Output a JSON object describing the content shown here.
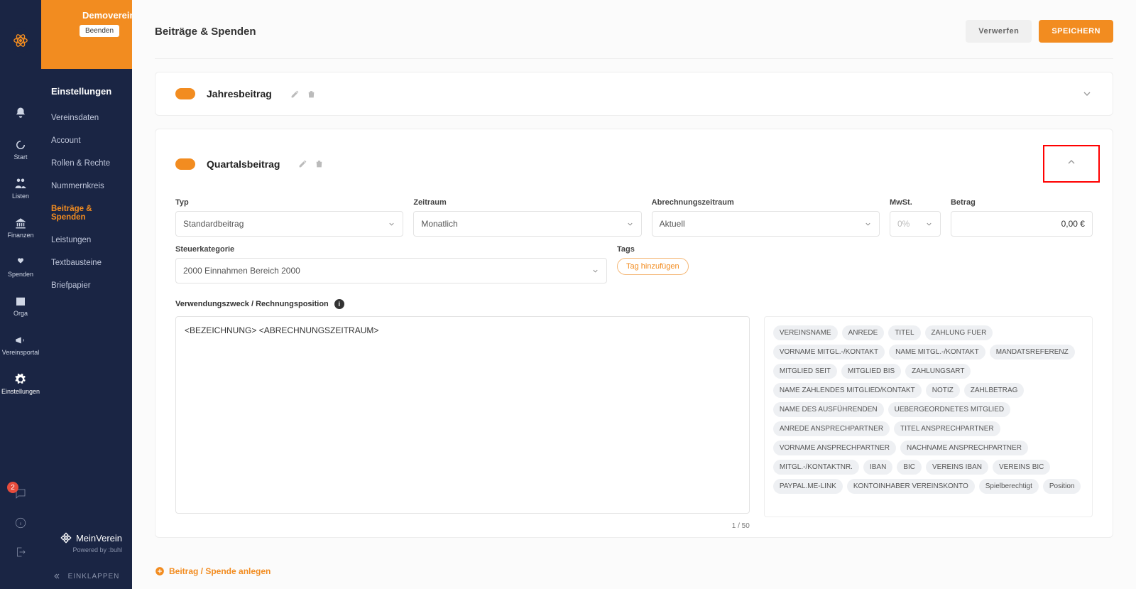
{
  "rail": {
    "items": [
      {
        "label": "",
        "name": "bell-icon"
      },
      {
        "label": "Start"
      },
      {
        "label": "Listen"
      },
      {
        "label": "Finanzen"
      },
      {
        "label": "Spenden"
      },
      {
        "label": "Orga"
      },
      {
        "label": "Vereinsportal"
      },
      {
        "label": "Einstellungen"
      }
    ],
    "badge": "2"
  },
  "brand": {
    "name": "Demoverein",
    "exit": "Beenden"
  },
  "sideTitle": "Einstellungen",
  "sideItems": [
    {
      "label": "Vereinsdaten"
    },
    {
      "label": "Account"
    },
    {
      "label": "Rollen & Rechte"
    },
    {
      "label": "Nummernkreis"
    },
    {
      "label": "Beiträge & Spenden",
      "active": true
    },
    {
      "label": "Leistungen"
    },
    {
      "label": "Textbausteine"
    },
    {
      "label": "Briefpapier"
    }
  ],
  "sideFooter": {
    "product": "MeinVerein",
    "powered": "Powered by :buhl",
    "collapse": "EINKLAPPEN"
  },
  "page": {
    "title": "Beiträge & Spenden",
    "discard": "Verwerfen",
    "save": "SPEICHERN"
  },
  "card1": {
    "title": "Jahresbeitrag"
  },
  "card2": {
    "title": "Quartalsbeitrag",
    "labels": {
      "typ": "Typ",
      "zeitraum": "Zeitraum",
      "abrechnung": "Abrechnungszeitraum",
      "mwst": "MwSt.",
      "betrag": "Betrag",
      "steuer": "Steuerkategorie",
      "tags": "Tags"
    },
    "values": {
      "typ": "Standardbeitrag",
      "zeitraum": "Monatlich",
      "abrechnung": "Aktuell",
      "mwst": "0%",
      "betrag": "0,00 €",
      "steuer": "2000 Einnahmen Bereich 2000",
      "tagAdd": "Tag hinzufügen"
    },
    "vzLabel": "Verwendungszweck / Rechnungsposition",
    "vzText": "<BEZEICHNUNG> <ABRECHNUNGSZEITRAUM>",
    "vzCount": "1 / 50",
    "tokens": [
      "VEREINSNAME",
      "ANREDE",
      "TITEL",
      "ZAHLUNG FUER",
      "VORNAME MITGL.-/KONTAKT",
      "NAME MITGL.-/KONTAKT",
      "MANDATSREFERENZ",
      "MITGLIED SEIT",
      "MITGLIED BIS",
      "ZAHLUNGSART",
      "NAME ZAHLENDES MITGLIED/KONTAKT",
      "NOTIZ",
      "ZAHLBETRAG",
      "NAME DES AUSFÜHRENDEN",
      "UEBERGEORDNETES MITGLIED",
      "ANREDE ANSPRECHPARTNER",
      "TITEL ANSPRECHPARTNER",
      "VORNAME ANSPRECHPARTNER",
      "NACHNAME ANSPRECHPARTNER",
      "MITGL.-/KONTAKTNR.",
      "IBAN",
      "BIC",
      "VEREINS IBAN",
      "VEREINS BIC",
      "PAYPAL.ME-LINK",
      "KONTOINHABER VEREINSKONTO",
      "Spielberechtigt",
      "Position"
    ]
  },
  "addRow": "Beitrag / Spende anlegen"
}
